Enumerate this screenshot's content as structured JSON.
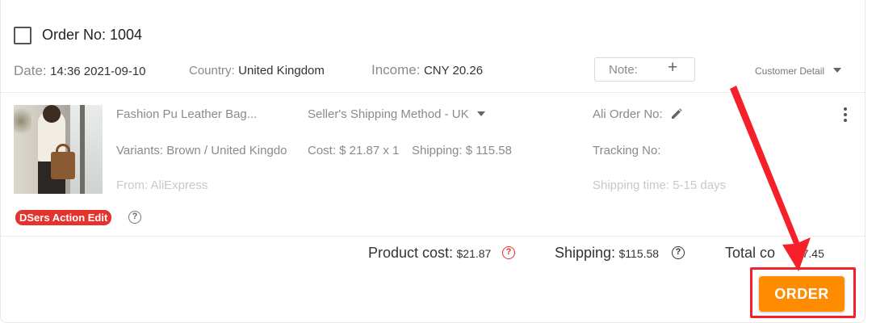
{
  "order": {
    "title": "Order No: 1004",
    "date_label": "Date:",
    "date_value": "14:36 2021-09-10",
    "country_label": "Country:",
    "country_value": "United Kingdom",
    "income_label": "Income:",
    "income_value": "CNY 20.26",
    "note_label": "Note:",
    "note_add_icon": "+",
    "customer_detail": "Customer Detail"
  },
  "product": {
    "name": "Fashion Pu Leather Bag...",
    "variants": "Variants: Brown / United Kingdo",
    "from": "From: AliExpress",
    "shipping_method": "Seller's Shipping Method - UK",
    "cost": "Cost: $ 21.87 x 1",
    "shipping": "Shipping: $ 115.58",
    "ali_order_label": "Ali Order No:",
    "tracking_label": "Tracking No:",
    "shipping_time": "Shipping time: 5-15 days",
    "action_badge": "DSers Action Edit",
    "image_icon": "product-thumbnail"
  },
  "totals": {
    "product_cost_label": "Product cost:",
    "product_cost_value": "$21.87",
    "shipping_label": "Shipping:",
    "shipping_value": "$115.58",
    "total_label": "Total co",
    "total_value": "137.45"
  },
  "actions": {
    "order_button": "ORDER"
  },
  "colors": {
    "accent_orange": "#ff8c00",
    "badge_red": "#e5322d",
    "highlight_red": "#f5202a"
  }
}
